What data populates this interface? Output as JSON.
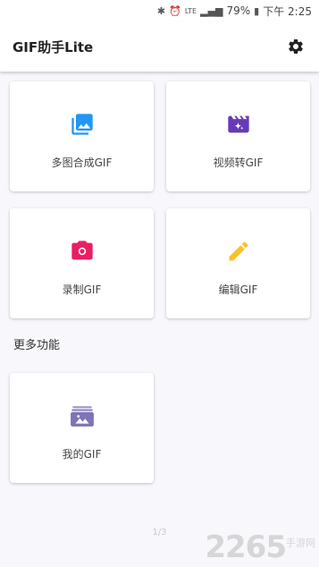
{
  "status_bar": {
    "battery": "79%",
    "time": "下午 2:25",
    "network": "LTE"
  },
  "app_bar": {
    "title": "GIF助手Lite",
    "settings_icon": "gear-icon"
  },
  "cards": [
    {
      "label": "多图合成GIF",
      "icon": "photo-library-icon",
      "color": "#2196f3"
    },
    {
      "label": "视频转GIF",
      "icon": "movie-clapper-icon",
      "color": "#673ab7"
    },
    {
      "label": "录制GIF",
      "icon": "camera-icon",
      "color": "#e91e63"
    },
    {
      "label": "编辑GIF",
      "icon": "pencil-icon",
      "color": "#fbc02d"
    }
  ],
  "section": {
    "title": "更多功能",
    "cards": [
      {
        "label": "我的GIF",
        "icon": "gallery-folder-icon",
        "color": "#7e74b8"
      }
    ]
  },
  "page_indicator": "1/3",
  "watermark": {
    "main": "2265",
    "sub": "手游网"
  }
}
